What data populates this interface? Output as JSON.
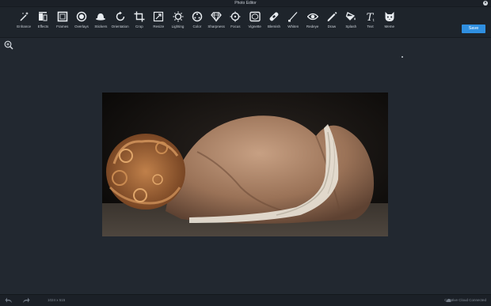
{
  "window": {
    "title": "Photo Editor"
  },
  "toolbar": {
    "tools": [
      {
        "label": "Enhance",
        "icon": "magic-wand-icon"
      },
      {
        "label": "Effects",
        "icon": "effects-icon"
      },
      {
        "label": "Frames",
        "icon": "frames-icon"
      },
      {
        "label": "Overlays",
        "icon": "overlays-icon"
      },
      {
        "label": "Stickers",
        "icon": "stickers-icon"
      },
      {
        "label": "Orientation",
        "icon": "orientation-icon"
      },
      {
        "label": "Crop",
        "icon": "crop-icon"
      },
      {
        "label": "Resize",
        "icon": "resize-icon"
      },
      {
        "label": "Lighting",
        "icon": "lighting-icon"
      },
      {
        "label": "Color",
        "icon": "color-icon"
      },
      {
        "label": "Sharpness",
        "icon": "sharpness-icon"
      },
      {
        "label": "Focus",
        "icon": "focus-icon"
      },
      {
        "label": "Vignette",
        "icon": "vignette-icon"
      },
      {
        "label": "Blemish",
        "icon": "blemish-icon"
      },
      {
        "label": "Whiten",
        "icon": "whiten-icon"
      },
      {
        "label": "Redeye",
        "icon": "redeye-icon"
      },
      {
        "label": "Draw",
        "icon": "draw-icon"
      },
      {
        "label": "Splash",
        "icon": "splash-icon"
      },
      {
        "label": "Text",
        "icon": "text-icon"
      },
      {
        "label": "Meme",
        "icon": "meme-icon"
      }
    ],
    "save_label": "Save"
  },
  "status": {
    "dimensions": "1024 x 515",
    "cloud": "Creative Cloud Connected"
  },
  "colors": {
    "accent": "#2f8fe0",
    "background": "#222830",
    "toolbar": "#1e242b"
  }
}
